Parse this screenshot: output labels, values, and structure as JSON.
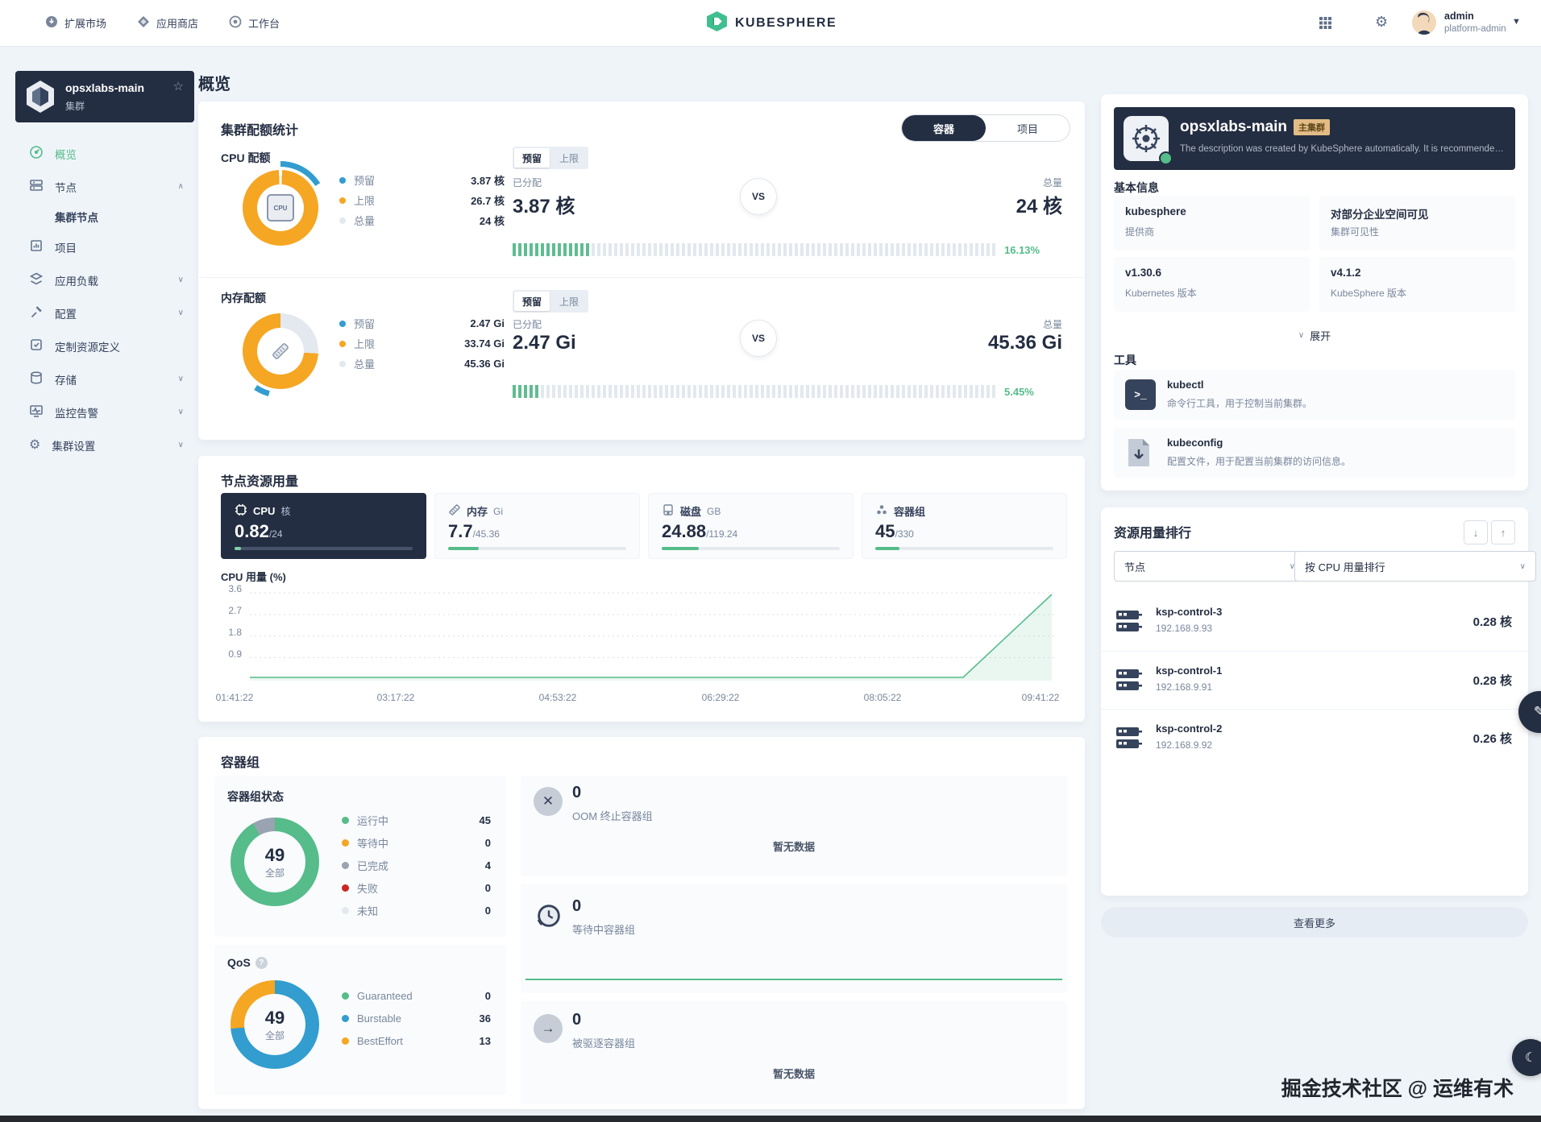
{
  "nav": {
    "items": [
      {
        "label": "扩展市场"
      },
      {
        "label": "应用商店"
      },
      {
        "label": "工作台"
      }
    ],
    "brand": "KUBESPHERE",
    "user": {
      "name": "admin",
      "role": "platform-admin"
    }
  },
  "sidebar": {
    "cluster": {
      "name": "opsxlabs-main",
      "type": "集群"
    },
    "menu": [
      {
        "label": "概览"
      },
      {
        "label": "节点"
      },
      {
        "label": "集群节点"
      },
      {
        "label": "项目"
      },
      {
        "label": "应用负载"
      },
      {
        "label": "配置"
      },
      {
        "label": "定制资源定义"
      },
      {
        "label": "存储"
      },
      {
        "label": "监控告警"
      },
      {
        "label": "集群设置"
      }
    ]
  },
  "page": {
    "title": "概览"
  },
  "quota": {
    "title": "集群配额统计",
    "view_toggle": {
      "options": [
        "容器",
        "项目"
      ],
      "active": "容器"
    },
    "rows": [
      {
        "name": "CPU 配额",
        "mode_toggle": [
          "预留",
          "上限"
        ],
        "legend": [
          {
            "label": "预留",
            "value": "3.87 核",
            "color": "#329dce"
          },
          {
            "label": "上限",
            "value": "26.7 核",
            "color": "#f5a623"
          },
          {
            "label": "总量",
            "value": "24 核",
            "color": "#e3e9ef"
          }
        ],
        "allocated_label": "已分配",
        "allocated": "3.87 核",
        "vs": "VS",
        "total_label": "总量",
        "total": "24 核",
        "percent": "16.13%",
        "percent_value": 16.13
      },
      {
        "name": "内存配额",
        "mode_toggle": [
          "预留",
          "上限"
        ],
        "legend": [
          {
            "label": "预留",
            "value": "2.47 Gi",
            "color": "#329dce"
          },
          {
            "label": "上限",
            "value": "33.74 Gi",
            "color": "#f5a623"
          },
          {
            "label": "总量",
            "value": "45.36 Gi",
            "color": "#e3e9ef"
          }
        ],
        "allocated_label": "已分配",
        "allocated": "2.47 Gi",
        "vs": "VS",
        "total_label": "总量",
        "total": "45.36 Gi",
        "percent": "5.45%",
        "percent_value": 5.45
      }
    ]
  },
  "node_usage": {
    "title": "节点资源用量",
    "tabs": [
      {
        "name": "CPU",
        "unit": "核",
        "value": "0.82",
        "total": "/24",
        "pct": 3.4,
        "active": true
      },
      {
        "name": "内存",
        "unit": "Gi",
        "value": "7.7",
        "total": "/45.36",
        "pct": 17
      },
      {
        "name": "磁盘",
        "unit": "GB",
        "value": "24.88",
        "total": "/119.24",
        "pct": 20.9
      },
      {
        "name": "容器组",
        "unit": "",
        "value": "45",
        "total": "/330",
        "pct": 13.6
      }
    ]
  },
  "chart_data": {
    "type": "area",
    "title": "CPU 用量 (%)",
    "x_labels": [
      "01:41:22",
      "03:17:22",
      "04:53:22",
      "06:29:22",
      "08:05:22",
      "09:41:22"
    ],
    "yticks": [
      "3.6",
      "2.7",
      "1.8",
      "0.9"
    ],
    "ylim": [
      0,
      3.85
    ],
    "series": [
      {
        "name": "CPU 用量",
        "points": [
          [
            0,
            0.07
          ],
          [
            0.5,
            0.07
          ],
          [
            0.88,
            0.07
          ],
          [
            1,
            3.8
          ]
        ],
        "note": "flat near 0.07% from 01:41:22, linear rise starting ~08:40 up to ~3.8% at 09:41:22"
      }
    ],
    "grid": "dotted horizontal",
    "line_color": "#55bc8a",
    "legend_position": "none"
  },
  "pods": {
    "title": "容器组",
    "status": {
      "title": "容器组状态",
      "total": "49",
      "total_label": "全部",
      "legend": [
        {
          "label": "运行中",
          "value": "45",
          "color": "#55bc8a"
        },
        {
          "label": "等待中",
          "value": "0",
          "color": "#f5a623"
        },
        {
          "label": "已完成",
          "value": "4",
          "color": "#99a3b1"
        },
        {
          "label": "失败",
          "value": "0",
          "color": "#ca2621"
        },
        {
          "label": "未知",
          "value": "0",
          "color": "#e3e9ef"
        }
      ]
    },
    "qos": {
      "title": "QoS",
      "total": "49",
      "total_label": "全部",
      "legend": [
        {
          "label": "Guaranteed",
          "value": "0",
          "color": "#55bc8a"
        },
        {
          "label": "Burstable",
          "value": "36",
          "color": "#329dce"
        },
        {
          "label": "BestEffort",
          "value": "13",
          "color": "#f5a623"
        }
      ]
    },
    "panels": [
      {
        "count": "0",
        "label": "OOM 终止容器组",
        "empty": "暂无数据"
      },
      {
        "count": "0",
        "label": "等待中容器组",
        "empty": ""
      },
      {
        "count": "0",
        "label": "被驱逐容器组",
        "empty": "暂无数据"
      }
    ]
  },
  "cluster_info": {
    "name": "opsxlabs-main",
    "badge": "主集群",
    "description": "The description was created by KubeSphere automatically. It is recommended...",
    "basic_title": "基本信息",
    "items": [
      {
        "value": "kubesphere",
        "label": "提供商"
      },
      {
        "value": "对部分企业空间可见",
        "label": "集群可见性"
      },
      {
        "value": "v1.30.6",
        "label": "Kubernetes 版本"
      },
      {
        "value": "v4.1.2",
        "label": "KubeSphere 版本"
      }
    ],
    "expand": "展开",
    "tools_title": "工具",
    "tools": [
      {
        "name": "kubectl",
        "desc": "命令行工具，用于控制当前集群。"
      },
      {
        "name": "kubeconfig",
        "desc": "配置文件，用于配置当前集群的访问信息。"
      }
    ]
  },
  "ranking": {
    "title": "资源用量排行",
    "filters": [
      {
        "value": "节点"
      },
      {
        "value": "按 CPU 用量排行"
      }
    ],
    "nodes": [
      {
        "name": "ksp-control-3",
        "ip": "192.168.9.93",
        "usage": "0.28 核"
      },
      {
        "name": "ksp-control-1",
        "ip": "192.168.9.91",
        "usage": "0.28 核"
      },
      {
        "name": "ksp-control-2",
        "ip": "192.168.9.92",
        "usage": "0.26 核"
      }
    ],
    "more": "查看更多"
  },
  "watermark": "掘金技术社区 @ 运维有术",
  "colors": {
    "green": "#55bc8a",
    "blue": "#329dce",
    "orange": "#f5a623",
    "red": "#ca2621",
    "dark": "#242e42",
    "gray_text": "#79879c",
    "track": "#e3e9ef",
    "bg": "#eff4f9"
  }
}
